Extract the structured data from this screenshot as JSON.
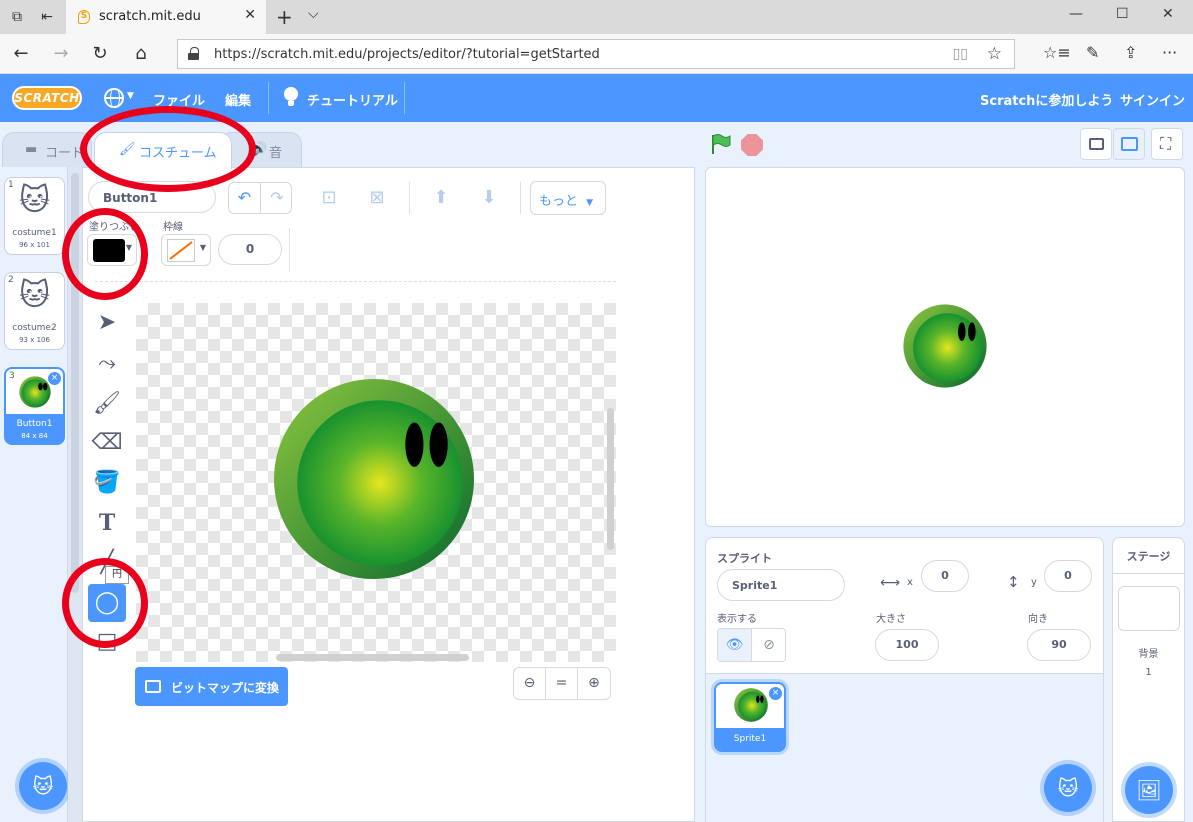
{
  "browser": {
    "tab_title": "scratch.mit.edu",
    "url": "https://scratch.mit.edu/projects/editor/?tutorial=getStarted"
  },
  "menubar": {
    "logo": "SCRATCH",
    "file": "ファイル",
    "edit": "編集",
    "tutorials": "チュートリアル",
    "join": "Scratchに参加しよう",
    "signin": "サインイン"
  },
  "editor_tabs": {
    "code": "コード",
    "costumes": "コスチューム",
    "sounds": "音"
  },
  "costumes": [
    {
      "index": "1",
      "name": "costume1",
      "size": "96 x 101"
    },
    {
      "index": "2",
      "name": "costume2",
      "size": "93 x 106"
    },
    {
      "index": "3",
      "name": "Button1",
      "size": "84 x 84"
    }
  ],
  "paint": {
    "costume_name": "Button1",
    "more": "もっと",
    "fill_label": "塗りつぶし",
    "outline_label": "枠線",
    "outline_width": "0",
    "tooltip": "円",
    "convert_bitmap": "ビットマップに変換",
    "zoom_reset": "="
  },
  "sprite_info": {
    "sprite_label": "スプライト",
    "sprite_name": "Sprite1",
    "x_label": "x",
    "x_value": "0",
    "y_label": "y",
    "y_value": "0",
    "show_label": "表示する",
    "size_label": "大きさ",
    "size_value": "100",
    "direction_label": "向き",
    "direction_value": "90"
  },
  "sprites": [
    {
      "name": "Sprite1"
    }
  ],
  "stage_pane": {
    "title": "ステージ",
    "backdrop_label": "背景",
    "backdrop_count": "1"
  },
  "colors": {
    "scratch_blue": "#4c97ff",
    "fill": "#000000",
    "annotation_red": "#e8001c",
    "button_green_dark": "#0a7a28",
    "button_green_light": "#e3e81e"
  }
}
